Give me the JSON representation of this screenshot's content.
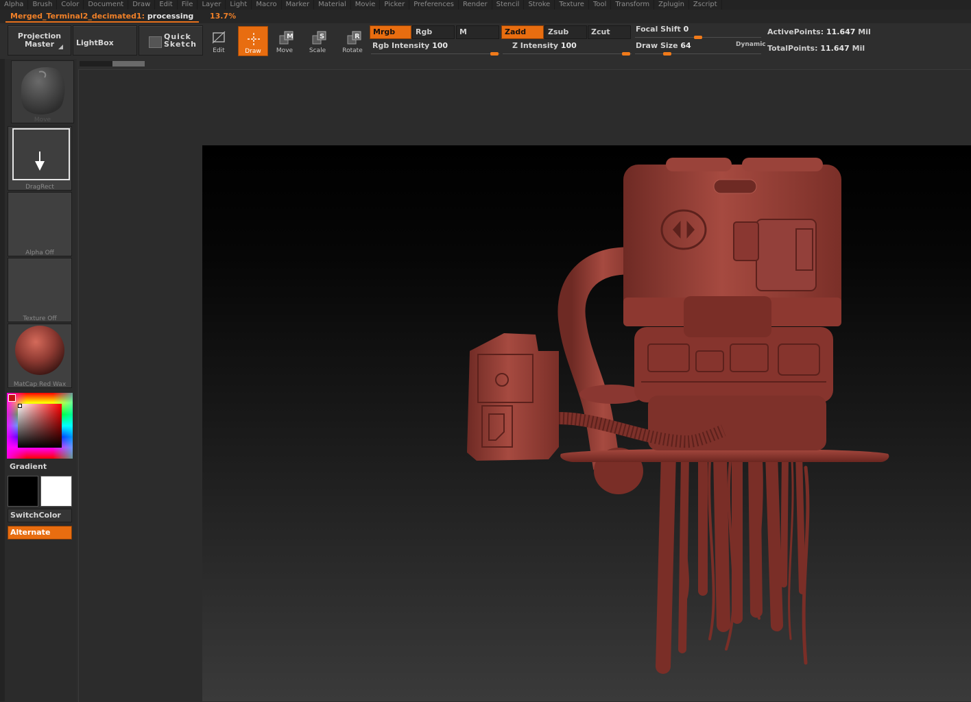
{
  "menu": [
    "Alpha",
    "Brush",
    "Color",
    "Document",
    "Draw",
    "Edit",
    "File",
    "Layer",
    "Light",
    "Macro",
    "Marker",
    "Material",
    "Movie",
    "Picker",
    "Preferences",
    "Render",
    "Stencil",
    "Stroke",
    "Texture",
    "Tool",
    "Transform",
    "Zplugin",
    "Zscript"
  ],
  "status": {
    "tool_name": "Merged_Terminal2_decimated1:",
    "state": "processing",
    "percent": "13.7%"
  },
  "toolbar": {
    "projection_master": [
      "Projection",
      "Master"
    ],
    "lightbox": "LightBox",
    "quick_sketch": [
      "Quick",
      "Sketch"
    ],
    "modes": [
      {
        "label": "Edit",
        "active": false
      },
      {
        "label": "Draw",
        "active": true
      },
      {
        "label": "Move",
        "active": false
      },
      {
        "label": "Scale",
        "active": false
      },
      {
        "label": "Rotate",
        "active": false
      }
    ],
    "mrgb": "Mrgb",
    "rgb": "Rgb",
    "m": "M",
    "zadd": "Zadd",
    "zsub": "Zsub",
    "zcut": "Zcut",
    "rgb_intensity": {
      "label": "Rgb Intensity",
      "value": "100"
    },
    "z_intensity": {
      "label": "Z Intensity",
      "value": "100"
    },
    "focal_shift": {
      "label": "Focal Shift",
      "value": "0"
    },
    "draw_size": {
      "label": "Draw Size",
      "value": "64"
    },
    "dynamic": "Dynamic",
    "active_points": {
      "label": "ActivePoints:",
      "value": "11.647",
      "unit": "Mil"
    },
    "total_points": {
      "label": "TotalPoints:",
      "value": "11.647",
      "unit": "Mil"
    }
  },
  "shelf": {
    "brush": "Move",
    "stroke": "DragRect",
    "alpha": "Alpha Off",
    "texture": "Texture Off",
    "material": "MatCap Red Wax",
    "gradient": "Gradient",
    "switch_color": "SwitchColor",
    "alternate": "Alternate"
  },
  "colors": {
    "accent": "#e86d10",
    "model": "#8e3a32"
  }
}
